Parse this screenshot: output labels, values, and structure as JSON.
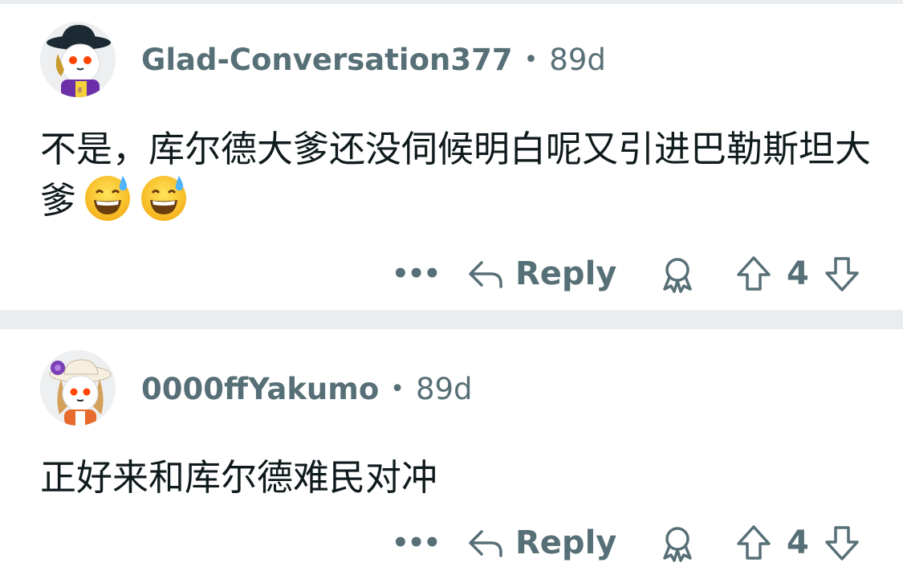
{
  "comments": [
    {
      "username": "Glad-Conversation377",
      "separator": "•",
      "age": "89d",
      "body": "不是，库尔德大爹还没伺候明白呢又引进巴勒斯坦大爹",
      "emojis": [
        "grinning-face-with-sweat",
        "grinning-face-with-sweat"
      ],
      "more_label": "•••",
      "reply_label": "Reply",
      "score": "4"
    },
    {
      "username": "0000ffYakumo",
      "separator": "•",
      "age": "89d",
      "body": "正好来和库尔德难民对冲",
      "more_label": "•••",
      "reply_label": "Reply",
      "score": "4"
    }
  ],
  "colors": {
    "meta_text": "#576f76",
    "body_text": "#0f1a1c",
    "divider": "#eaedef",
    "avatar_bg": "#edeff1"
  },
  "icons": [
    "more-icon",
    "reply-arrow-icon",
    "award-icon",
    "upvote-icon",
    "downvote-icon"
  ]
}
